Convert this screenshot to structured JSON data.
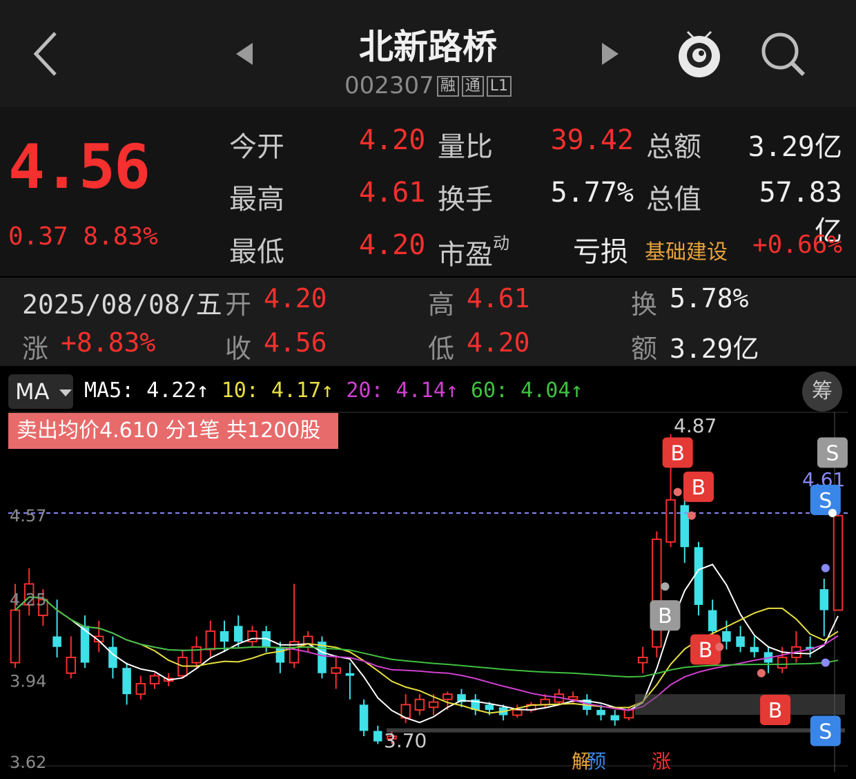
{
  "header": {
    "stock_name": "北新路桥",
    "stock_code": "002307",
    "tags": [
      "融",
      "通",
      "L1"
    ]
  },
  "quote": {
    "price": "4.56",
    "change": "0.37",
    "change_pct": "8.83%",
    "rows": [
      {
        "l1": "今开",
        "v1": "4.20",
        "l2": "量比",
        "v2": "39.42",
        "l3": "总额",
        "v3": "3.29亿"
      },
      {
        "l1": "最高",
        "v1": "4.61",
        "l2": "换手",
        "v2": "5.77%",
        "l3": "总值",
        "v3": "57.83亿"
      },
      {
        "l1": "最低",
        "v1": "4.20",
        "l2": "市盈",
        "l2_sup": "动",
        "v2": "",
        "l3": "亏损",
        "v3": "+0.66%"
      }
    ],
    "sector": "基础建设"
  },
  "day_info": {
    "date": "2025/08/08/五",
    "change_label": "涨",
    "change_value": "+8.83%",
    "open_label": "开",
    "open_value": "4.20",
    "close_label": "收",
    "close_value": "4.56",
    "high_label": "高",
    "high_value": "4.61",
    "low_label": "低",
    "low_value": "4.20",
    "turnover_label": "换",
    "turnover_value": "5.78%",
    "amount_label": "额",
    "amount_value": "3.29亿"
  },
  "indicators": {
    "selector": "MA",
    "ma5": "MA5: 4.22↑",
    "ma10": "10: 4.17↑",
    "ma20": "20: 4.14↑",
    "ma60": "60: 4.04↑",
    "chip_button": "筹",
    "colors": {
      "ma5": "#ffffff",
      "ma10": "#e8e040",
      "ma20": "#d040d0",
      "ma60": "#40c040"
    }
  },
  "sell_banner": "卖出均价4.610 分1笔 共1200股",
  "chart_data": {
    "type": "candlestick",
    "y_ticks": [
      "4.57",
      "4.25",
      "3.94",
      "3.62"
    ],
    "ylim": [
      3.62,
      4.93
    ],
    "current_price_line": "4.57",
    "right_price_label": "4.61",
    "high_annotation": "4.87",
    "low_annotation": "3.70",
    "event_labels": [
      "解",
      "预",
      "涨"
    ],
    "trade_marks": [
      {
        "type": "B",
        "value": 4.8
      },
      {
        "type": "B",
        "value": 4.67
      },
      {
        "type": "B",
        "value": 4.05
      },
      {
        "type": "B",
        "value": 3.82
      },
      {
        "type": "B",
        "value": 3.71
      },
      {
        "type": "S",
        "value": 4.8
      },
      {
        "type": "S",
        "value": 4.62
      },
      {
        "type": "S",
        "value": 3.74
      }
    ],
    "colors": {
      "up": "#f5302e",
      "down": "#3fe0e8"
    },
    "candles": [
      {
        "o": 4.0,
        "c": 4.2,
        "h": 4.3,
        "l": 3.98
      },
      {
        "o": 4.22,
        "c": 4.3,
        "h": 4.36,
        "l": 4.18
      },
      {
        "o": 4.18,
        "c": 4.24,
        "h": 4.28,
        "l": 4.14
      },
      {
        "o": 4.1,
        "c": 4.06,
        "h": 4.24,
        "l": 4.02
      },
      {
        "o": 3.96,
        "c": 4.02,
        "h": 4.1,
        "l": 3.94
      },
      {
        "o": 4.14,
        "c": 4.0,
        "h": 4.18,
        "l": 3.98
      },
      {
        "o": 4.08,
        "c": 4.1,
        "h": 4.16,
        "l": 4.04
      },
      {
        "o": 4.06,
        "c": 3.98,
        "h": 4.1,
        "l": 3.94
      },
      {
        "o": 3.98,
        "c": 3.88,
        "h": 4.0,
        "l": 3.84
      },
      {
        "o": 3.88,
        "c": 3.92,
        "h": 3.95,
        "l": 3.86
      },
      {
        "o": 3.92,
        "c": 3.95,
        "h": 3.96,
        "l": 3.9
      },
      {
        "o": 3.93,
        "c": 3.94,
        "h": 3.96,
        "l": 3.91
      },
      {
        "o": 3.95,
        "c": 4.02,
        "h": 4.05,
        "l": 3.94
      },
      {
        "o": 4.0,
        "c": 4.06,
        "h": 4.1,
        "l": 3.98
      },
      {
        "o": 4.05,
        "c": 4.12,
        "h": 4.16,
        "l": 4.02
      },
      {
        "o": 4.12,
        "c": 4.08,
        "h": 4.16,
        "l": 4.04
      },
      {
        "o": 4.14,
        "c": 4.08,
        "h": 4.18,
        "l": 4.06
      },
      {
        "o": 4.08,
        "c": 4.12,
        "h": 4.14,
        "l": 4.06
      },
      {
        "o": 4.12,
        "c": 4.06,
        "h": 4.14,
        "l": 4.04
      },
      {
        "o": 4.06,
        "c": 4.0,
        "h": 4.08,
        "l": 3.96
      },
      {
        "o": 4.0,
        "c": 4.08,
        "h": 4.3,
        "l": 3.98
      },
      {
        "o": 4.06,
        "c": 4.1,
        "h": 4.12,
        "l": 4.04
      },
      {
        "o": 4.08,
        "c": 3.96,
        "h": 4.1,
        "l": 3.94
      },
      {
        "o": 3.96,
        "c": 3.98,
        "h": 4.02,
        "l": 3.9
      },
      {
        "o": 3.96,
        "c": 3.95,
        "h": 4.0,
        "l": 3.86
      },
      {
        "o": 3.84,
        "c": 3.74,
        "h": 3.86,
        "l": 3.72
      },
      {
        "o": 3.74,
        "c": 3.7,
        "h": 3.76,
        "l": 3.69
      },
      {
        "o": 3.71,
        "c": 3.72,
        "h": 3.74,
        "l": 3.69
      },
      {
        "o": 3.79,
        "c": 3.84,
        "h": 3.88,
        "l": 3.77
      },
      {
        "o": 3.82,
        "c": 3.86,
        "h": 3.88,
        "l": 3.8
      },
      {
        "o": 3.83,
        "c": 3.85,
        "h": 3.88,
        "l": 3.8
      },
      {
        "o": 3.86,
        "c": 3.88,
        "h": 3.89,
        "l": 3.82
      },
      {
        "o": 3.88,
        "c": 3.85,
        "h": 3.9,
        "l": 3.83
      },
      {
        "o": 3.86,
        "c": 3.82,
        "h": 3.88,
        "l": 3.8
      },
      {
        "o": 3.84,
        "c": 3.82,
        "h": 3.85,
        "l": 3.8
      },
      {
        "o": 3.83,
        "c": 3.8,
        "h": 3.84,
        "l": 3.78
      },
      {
        "o": 3.8,
        "c": 3.82,
        "h": 3.84,
        "l": 3.79
      },
      {
        "o": 3.82,
        "c": 3.84,
        "h": 3.85,
        "l": 3.81
      },
      {
        "o": 3.84,
        "c": 3.86,
        "h": 3.88,
        "l": 3.83
      },
      {
        "o": 3.85,
        "c": 3.88,
        "h": 3.9,
        "l": 3.84
      },
      {
        "o": 3.86,
        "c": 3.87,
        "h": 3.89,
        "l": 3.84
      },
      {
        "o": 3.86,
        "c": 3.82,
        "h": 3.88,
        "l": 3.8
      },
      {
        "o": 3.82,
        "c": 3.8,
        "h": 3.84,
        "l": 3.78
      },
      {
        "o": 3.8,
        "c": 3.78,
        "h": 3.82,
        "l": 3.76
      },
      {
        "o": 3.79,
        "c": 3.82,
        "h": 3.83,
        "l": 3.78
      },
      {
        "o": 4.0,
        "c": 4.02,
        "h": 4.06,
        "l": 3.96
      },
      {
        "o": 4.06,
        "c": 4.47,
        "h": 4.5,
        "l": 4.02
      },
      {
        "o": 4.46,
        "c": 4.62,
        "h": 4.87,
        "l": 4.44
      },
      {
        "o": 4.6,
        "c": 4.44,
        "h": 4.64,
        "l": 4.38
      },
      {
        "o": 4.44,
        "c": 4.22,
        "h": 4.46,
        "l": 4.18
      },
      {
        "o": 4.2,
        "c": 4.12,
        "h": 4.24,
        "l": 4.08
      },
      {
        "o": 4.12,
        "c": 4.08,
        "h": 4.16,
        "l": 4.05
      },
      {
        "o": 4.1,
        "c": 4.06,
        "h": 4.14,
        "l": 4.04
      },
      {
        "o": 4.06,
        "c": 4.04,
        "h": 4.1,
        "l": 4.02
      },
      {
        "o": 4.04,
        "c": 4.0,
        "h": 4.06,
        "l": 3.96
      },
      {
        "o": 3.98,
        "c": 4.02,
        "h": 4.06,
        "l": 3.96
      },
      {
        "o": 4.02,
        "c": 4.06,
        "h": 4.12,
        "l": 4.0
      },
      {
        "o": 4.06,
        "c": 4.05,
        "h": 4.1,
        "l": 4.02
      },
      {
        "o": 4.28,
        "c": 4.2,
        "h": 4.32,
        "l": 4.1
      },
      {
        "o": 4.2,
        "c": 4.56,
        "h": 4.61,
        "l": 4.2
      }
    ]
  }
}
